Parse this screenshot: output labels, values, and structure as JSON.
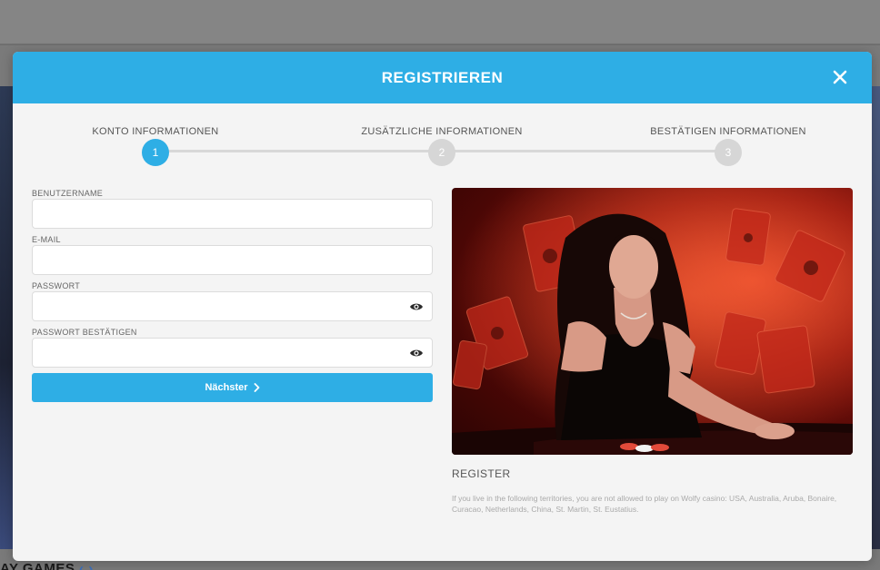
{
  "background": {
    "footer_text_prefix": "AY GAMES",
    "footer_text_suffix": "‹ ›"
  },
  "modal": {
    "title": "REGISTRIEREN",
    "close_icon": "close-icon"
  },
  "stepper": {
    "steps": [
      {
        "label": "KONTO INFORMATIONEN",
        "number": "1",
        "active": true
      },
      {
        "label": "ZUSÄTZLICHE INFORMATIONEN",
        "number": "2",
        "active": false
      },
      {
        "label": "BESTÄTIGEN INFORMATIONEN",
        "number": "3",
        "active": false
      }
    ]
  },
  "form": {
    "username_label": "BENUTZERNAME",
    "username_value": "",
    "email_label": "E-MAIL",
    "email_value": "",
    "password_label": "PASSWORT",
    "password_value": "",
    "password_confirm_label": "PASSWORT BESTÄTIGEN",
    "password_confirm_value": "",
    "next_label": "Nächster"
  },
  "promo": {
    "heading": "REGISTER",
    "disclaimer": "If you live in the following territories, you are not allowed to play on Wolfy casino: USA, Australia, Aruba, Bonaire, Curacao, Netherlands, China, St. Martin, St. Eustatius."
  },
  "colors": {
    "accent": "#2eaee5",
    "inactive_step": "#d6d6d6",
    "modal_bg": "#f4f4f4"
  }
}
